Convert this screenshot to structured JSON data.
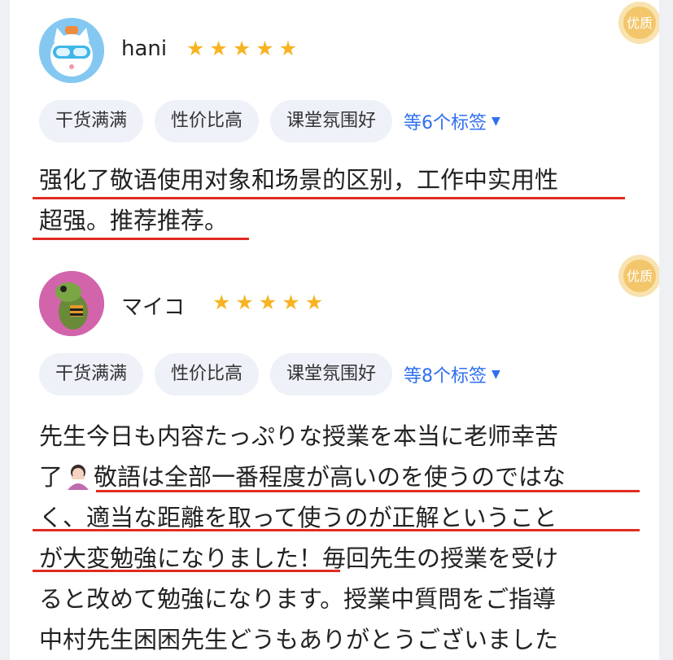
{
  "reviews": [
    {
      "username": "hani",
      "rating_stars": 5,
      "avatar_icon": "cat-with-goggles-avatar",
      "badge_text": "优质",
      "tags": [
        "干货满满",
        "性价比高",
        "课堂氛围好"
      ],
      "more_tags": "等6个标签",
      "comment_lines": [
        "强化了敬语使用对象和场景的区别，工作中实用性",
        "超强。推荐推荐。"
      ]
    },
    {
      "username": "マイコ",
      "rating_stars": 5,
      "avatar_icon": "green-frog-avatar",
      "badge_text": "优质",
      "tags": [
        "干货满满",
        "性价比高",
        "课堂氛围好"
      ],
      "more_tags": "等8个标签",
      "comment_lines": [
        "先生今日も内容たっぷりな授業を本当に老师幸苦",
        "了",
        "敬語は全部一番程度が高いのを使うのではな",
        "く、適当な距離を取って使うのが正解ということ",
        "が大変勉強になりました！毎回先生の授業を受け",
        "ると改めて勉強になります。授業中質問をご指導",
        "中村先生困困先生どうもありがとうございました"
      ]
    }
  ],
  "colors": {
    "star": "#f8b323",
    "tag_bg": "#eef1f8",
    "more_tags": "#2f6ff0",
    "underline": "#e12b22",
    "badge": "#f3c66b"
  }
}
